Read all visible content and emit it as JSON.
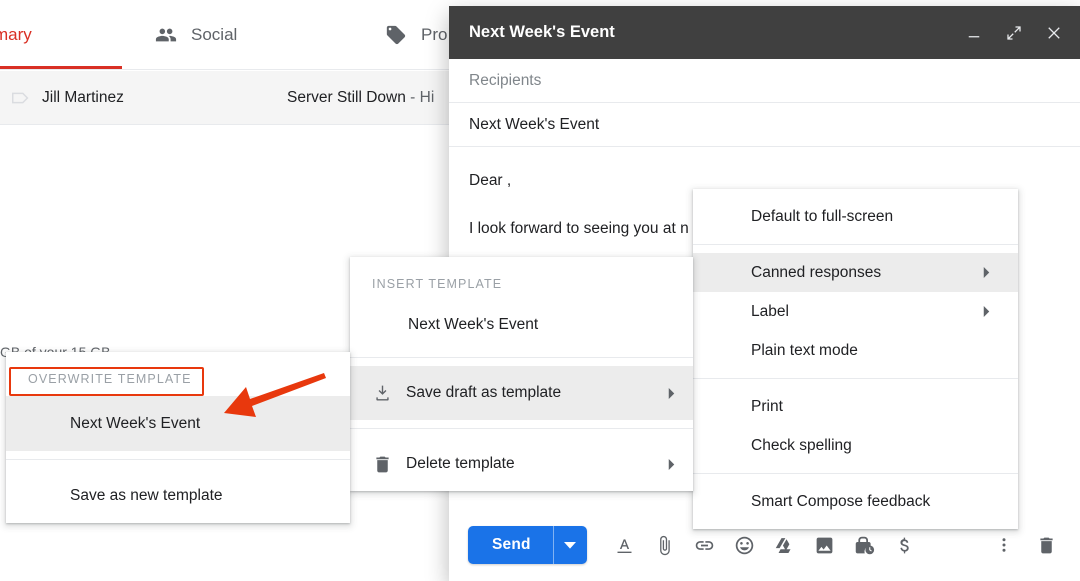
{
  "gmail": {
    "tabs": [
      {
        "label": "mary",
        "icon": "inbox-icon",
        "active": true
      },
      {
        "label": "Social",
        "icon": "people-icon",
        "active": false
      },
      {
        "label": "Pro",
        "icon": "tag-icon",
        "active": false
      }
    ],
    "mail_row": {
      "sender": "Jill Martinez",
      "subject": "Server Still Down",
      "separator": " - ",
      "snippet": "Hi"
    },
    "storage_text": "GB of your 15 GB",
    "accent_color": "#d93025"
  },
  "compose": {
    "title": "Next Week's Event",
    "window_controls": [
      {
        "name": "minimize-button",
        "icon": "minimize-icon"
      },
      {
        "name": "fullscreen-button",
        "icon": "expand-icon"
      },
      {
        "name": "close-button",
        "icon": "close-icon"
      }
    ],
    "recipients_placeholder": "Recipients",
    "subject_value": "Next Week's Event",
    "body_lines": [
      "Dear ,",
      "I look forward to seeing you at n"
    ],
    "toolbar": {
      "send_label": "Send",
      "send_color": "#1a73e8",
      "icons": [
        {
          "name": "formatting-options-icon",
          "label": "Formatting options"
        },
        {
          "name": "attach-file-icon",
          "label": "Attach files"
        },
        {
          "name": "insert-link-icon",
          "label": "Insert link"
        },
        {
          "name": "insert-emoji-icon",
          "label": "Insert emoji"
        },
        {
          "name": "insert-drive-icon",
          "label": "Insert files using Drive"
        },
        {
          "name": "insert-photo-icon",
          "label": "Insert photo"
        },
        {
          "name": "confidential-mode-icon",
          "label": "Confidential mode"
        },
        {
          "name": "insert-signature-icon",
          "label": "Insert money"
        }
      ],
      "more_options_label": "More options",
      "discard_label": "Discard draft"
    }
  },
  "menus": {
    "options": {
      "items": [
        {
          "label": "Default to full-screen",
          "submenu": false,
          "highlight": false
        },
        {
          "separator": true
        },
        {
          "label": "Canned responses",
          "submenu": true,
          "highlight": true
        },
        {
          "label": "Label",
          "submenu": true,
          "highlight": false
        },
        {
          "label": "Plain text mode",
          "submenu": false,
          "highlight": false
        },
        {
          "separator": true
        },
        {
          "label": "Print",
          "submenu": false,
          "highlight": false
        },
        {
          "label": "Check spelling",
          "submenu": false,
          "highlight": false
        },
        {
          "separator": true
        },
        {
          "label": "Smart Compose feedback",
          "submenu": false,
          "highlight": false
        }
      ]
    },
    "templates": {
      "header": "INSERT TEMPLATE",
      "template_item": "Next Week's Event",
      "items": [
        {
          "label": "Save draft as template",
          "icon": "save-template-icon",
          "submenu": true,
          "highlight": true
        },
        {
          "label": "Delete template",
          "icon": "trash-icon",
          "submenu": true,
          "highlight": false
        }
      ]
    },
    "overwrite": {
      "header": "OVERWRITE TEMPLATE",
      "items": [
        {
          "label": "Next Week's Event",
          "highlight": true
        },
        {
          "label": "Save as new template",
          "highlight": false
        }
      ]
    }
  },
  "annotation": {
    "color": "#e8380d",
    "highlight_target": "OVERWRITE TEMPLATE",
    "arrow_points_to": "Next Week's Event"
  }
}
